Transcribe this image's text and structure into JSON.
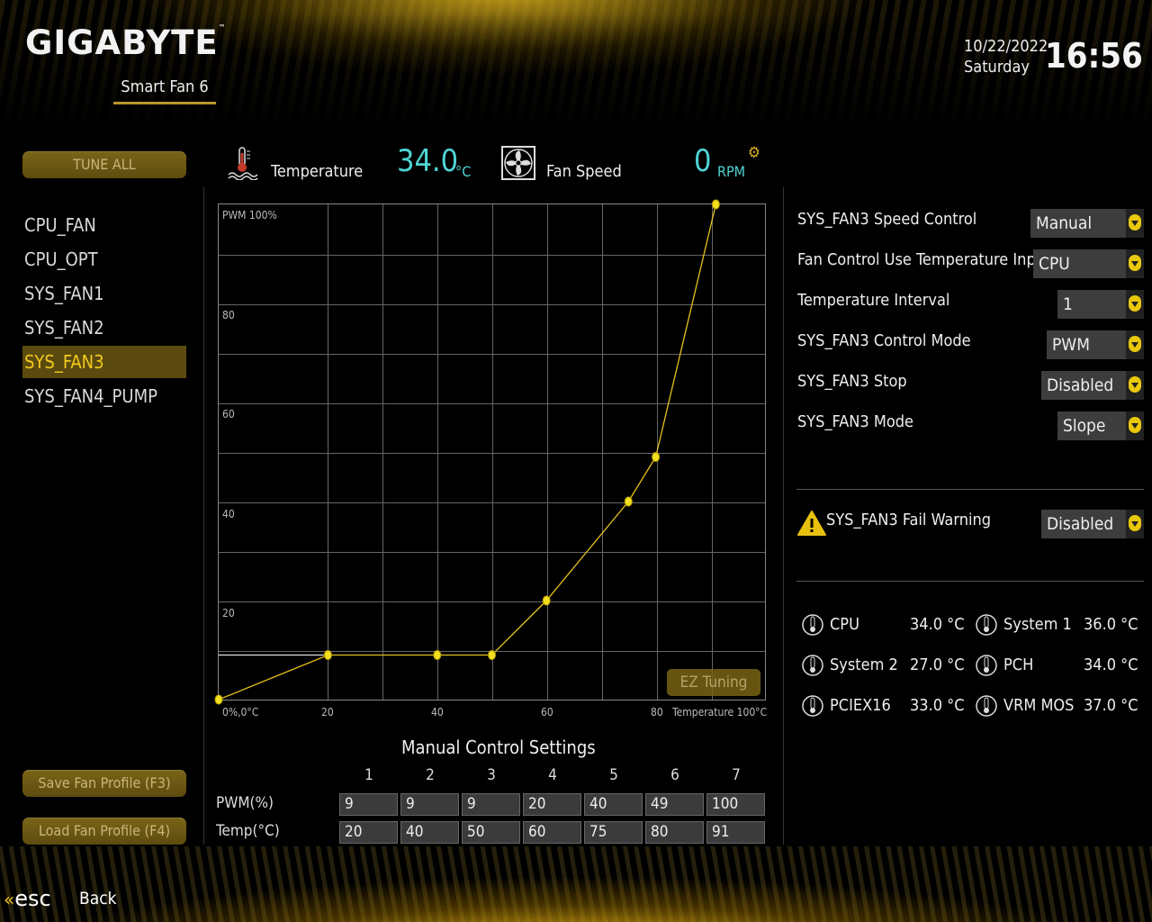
{
  "header": {
    "brand": "GIGABYTE",
    "tm": "™",
    "page_title": "Smart Fan 6",
    "date": "10/22/2022",
    "weekday": "Saturday",
    "time": "16:56"
  },
  "sidebar": {
    "tune_all": "TUNE ALL",
    "fans": [
      "CPU_FAN",
      "CPU_OPT",
      "SYS_FAN1",
      "SYS_FAN2",
      "SYS_FAN3",
      "SYS_FAN4_PUMP"
    ],
    "selected_index": 4,
    "save_profile": "Save Fan Profile (F3)",
    "load_profile": "Load Fan Profile (F4)"
  },
  "status": {
    "temperature_label": "Temperature",
    "temperature_value": "34.0",
    "temperature_unit": "°C",
    "fan_speed_label": "Fan Speed",
    "fan_speed_value": "0",
    "fan_speed_unit": "RPM"
  },
  "chart_data": {
    "type": "line",
    "x_label": "Temperature 100°C",
    "y_label": "PWM 100%",
    "origin_label": "0%,0°C",
    "x_ticks": [
      "20",
      "40",
      "60",
      "80"
    ],
    "y_ticks": [
      "80",
      "60",
      "40",
      "20"
    ],
    "xlim": [
      0,
      100
    ],
    "ylim": [
      0,
      100
    ],
    "grid": true,
    "series": [
      {
        "points": [
          [
            0,
            0
          ],
          [
            20,
            9
          ],
          [
            40,
            9
          ],
          [
            50,
            9
          ],
          [
            60,
            20
          ],
          [
            75,
            40
          ],
          [
            80,
            49
          ],
          [
            91,
            100
          ]
        ]
      }
    ],
    "line_color": "#e6c21a"
  },
  "ez_tuning": "EZ Tuning",
  "manual": {
    "title": "Manual Control Settings",
    "columns": [
      "1",
      "2",
      "3",
      "4",
      "5",
      "6",
      "7"
    ],
    "pwm_label": "PWM(%)",
    "temp_label": "Temp(°C)",
    "pwm": [
      "9",
      "9",
      "9",
      "20",
      "40",
      "49",
      "100"
    ],
    "temp": [
      "20",
      "40",
      "50",
      "60",
      "75",
      "80",
      "91"
    ]
  },
  "settings": [
    {
      "label": "SYS_FAN3 Speed Control",
      "value": "Manual"
    },
    {
      "label": "Fan Control Use Temperature Input",
      "value": "CPU"
    },
    {
      "label": "Temperature Interval",
      "value": "1"
    },
    {
      "label": "SYS_FAN3 Control Mode",
      "value": "PWM"
    },
    {
      "label": "SYS_FAN3 Stop",
      "value": "Disabled"
    },
    {
      "label": "SYS_FAN3 Mode",
      "value": "Slope"
    }
  ],
  "fail_warning": {
    "label": "SYS_FAN3 Fail Warning",
    "value": "Disabled"
  },
  "temps": [
    {
      "name": "CPU",
      "value": "34.0 °C"
    },
    {
      "name": "System 1",
      "value": "36.0 °C"
    },
    {
      "name": "System 2",
      "value": "27.0 °C"
    },
    {
      "name": "PCH",
      "value": "34.0 °C"
    },
    {
      "name": "PCIEX16",
      "value": "33.0 °C"
    },
    {
      "name": "VRM MOS",
      "value": "37.0 °C"
    }
  ],
  "footer": {
    "esc": "esc",
    "back": "Back"
  }
}
